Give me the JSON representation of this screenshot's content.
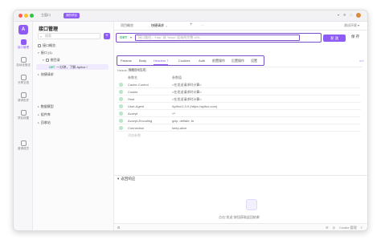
{
  "titlebar": {
    "home": "主窗口",
    "badge": "我的项目",
    "right_items": [
      "▾",
      "⚙",
      "□"
    ]
  },
  "rail": {
    "logo": "A",
    "items": [
      {
        "label": "接口管理",
        "active": true
      },
      {
        "label": "自动化测试",
        "active": false
      },
      {
        "label": "分享文档",
        "active": false
      },
      {
        "label": "请求历史",
        "active": false
      },
      {
        "label": "项目设置",
        "active": false
      },
      {
        "label": "邀请成员",
        "active": false
      }
    ]
  },
  "sidebar": {
    "title": "接口管理",
    "search_placeholder": "搜索",
    "add_label": "+",
    "rows": [
      {
        "label": "接口概览",
        "indent": 0
      },
      {
        "label": "接口 (1)",
        "indent": 0,
        "arrow": "▾"
      },
      {
        "label": "根目录",
        "indent": 1,
        "arrow": "▾"
      },
      {
        "method": "GET",
        "label": "一分钟，了解 Apifox !",
        "indent": 2,
        "selected": true
      },
      {
        "label": "快捷请求",
        "indent": 0,
        "arrow": "▸"
      },
      {
        "label": "数据模型",
        "indent": 0,
        "arrow": "▸"
      },
      {
        "label": "组件库",
        "indent": 0,
        "arrow": "▸"
      },
      {
        "label": "回收站",
        "indent": 0,
        "arrow": "▸"
      }
    ]
  },
  "tabs": {
    "items": [
      {
        "label": "项目概览",
        "active": false
      },
      {
        "label": "快捷请求",
        "active": true
      }
    ],
    "plus": "+",
    "more": "···",
    "env": "测试环境 ▾"
  },
  "request": {
    "method": "GET",
    "url_placeholder": "接口路径，\"http\" 或 \"https\" 起始的完整 URL",
    "send_label": "发 送",
    "save_label": "保 存"
  },
  "subtabs": {
    "items": [
      "Params",
      "Body",
      "Headers 7",
      "Cookies",
      "Auth",
      "前置操作",
      "后置操作",
      "设置"
    ],
    "active_index": 2,
    "cookie_link": "Cookie 管理"
  },
  "headers": {
    "label": "Headers",
    "toggle": "隐藏自动生成",
    "col_name": "参数名",
    "col_value": "参数值",
    "rows": [
      {
        "key": "Cache-Control",
        "value": "<在发送请求时计算>"
      },
      {
        "key": "Cookie",
        "value": "<在发送请求时计算>"
      },
      {
        "key": "Host",
        "value": "<在发送请求时计算>"
      },
      {
        "key": "User-Agent",
        "value": "Apifox/1.0.0 (https://apifox.com)"
      },
      {
        "key": "Accept",
        "value": "*/*"
      },
      {
        "key": "Accept-Encoding",
        "value": "gzip, deflate, br"
      },
      {
        "key": "Connection",
        "value": "keep-alive"
      }
    ],
    "add_placeholder": "添加参数"
  },
  "response": {
    "title": "返回响应",
    "empty_text": "点击\"发送\"按钮获取返回结果"
  },
  "statusbar": {
    "left": "⊞",
    "right": [
      "☰",
      "◎",
      "Cookie 管理",
      "≡"
    ]
  },
  "colors": {
    "accent": "#8e5cf5",
    "highlight_border": "#7b4fc9",
    "method_get": "#2bb673"
  }
}
